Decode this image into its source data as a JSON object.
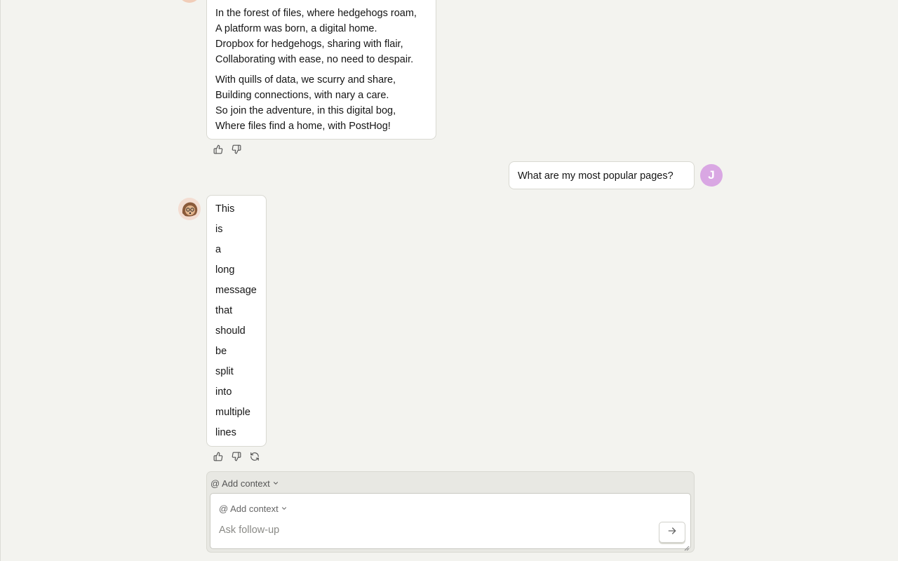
{
  "messages": {
    "poem": {
      "stanza1": [
        "In the forest of files, where hedgehogs roam,",
        "A platform was born, a digital home.",
        "Dropbox for hedgehogs, sharing with flair,",
        "Collaborating with ease, no need to despair."
      ],
      "stanza2": [
        "With quills of data, we scurry and share,",
        "Building connections, with nary a care.",
        "So join the adventure, in this digital bog,",
        "Where files find a home, with PostHog!"
      ]
    },
    "user_question": "What are my most popular pages?",
    "user_initial": "J",
    "long_message_words": [
      "This",
      "is",
      "a",
      "long",
      "message",
      "that",
      "should",
      "be",
      "split",
      "into",
      "multiple",
      "lines"
    ]
  },
  "composer": {
    "context_label": "@ Add context",
    "inner_context_label": "@ Add context",
    "placeholder": "Ask follow-up"
  },
  "icons": {
    "thumbs_up": "thumbs-up-icon",
    "thumbs_down": "thumbs-down-icon",
    "retry": "retry-icon",
    "send": "arrow-right-icon",
    "chevron": "chevron-down-icon"
  },
  "colors": {
    "background": "#f3f3ef",
    "user_avatar": "#d9a7e3"
  }
}
